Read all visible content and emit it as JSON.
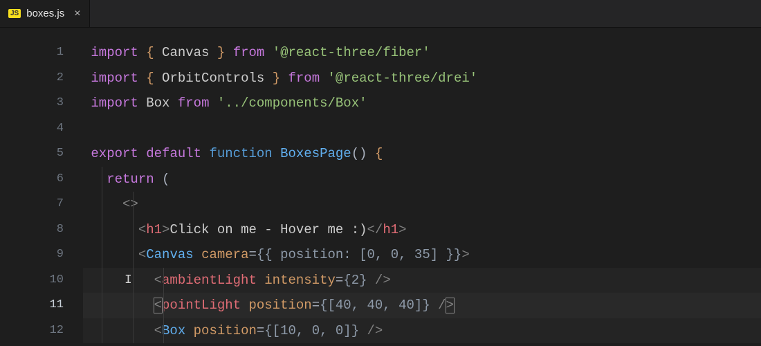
{
  "tab": {
    "filename": "boxes.js",
    "badge": "JS"
  },
  "code": {
    "l1": {
      "import": "import",
      "lbrace": "{",
      "id": "Canvas",
      "rbrace": "}",
      "from": "from",
      "str": "'@react-three/fiber'"
    },
    "l2": {
      "import": "import",
      "lbrace": "{",
      "id": "OrbitControls",
      "rbrace": "}",
      "from": "from",
      "str": "'@react-three/drei'"
    },
    "l3": {
      "import": "import",
      "id": "Box",
      "from": "from",
      "str": "'../components/Box'"
    },
    "l5": {
      "export": "export",
      "default": "default",
      "funcword": "function",
      "name": "BoxesPage",
      "parens": "()",
      "brace": "{"
    },
    "l6": {
      "return": "return",
      "paren": "("
    },
    "l7": {
      "frag": "<>"
    },
    "l8": {
      "open": "<",
      "tag": "h1",
      "gt": ">",
      "text": "Click on me - Hover me :)",
      "open2": "</",
      "tag2": "h1",
      "gt2": ">"
    },
    "l9": {
      "open": "<",
      "tag": "Canvas",
      "attr": "camera",
      "eq": "=",
      "arg": "{{ position: [0, 0, 35] }}",
      "gt": ">"
    },
    "l10": {
      "open": "<",
      "tag": "ambientLight",
      "attr": "intensity",
      "eq": "=",
      "arg": "{2}",
      "close": "/>"
    },
    "l11": {
      "open": "<",
      "tag": "pointLight",
      "attr": "position",
      "eq": "=",
      "arg": "{[40, 40, 40]}",
      "close": "/>"
    },
    "l12": {
      "open": "<",
      "tag": "Box",
      "attr": "position",
      "eq": "=",
      "arg": "{[10, 0, 0]}",
      "close": "/>"
    }
  },
  "lineNumbers": [
    "1",
    "2",
    "3",
    "4",
    "5",
    "6",
    "7",
    "8",
    "9",
    "10",
    "11",
    "12"
  ],
  "activeLine": 11
}
